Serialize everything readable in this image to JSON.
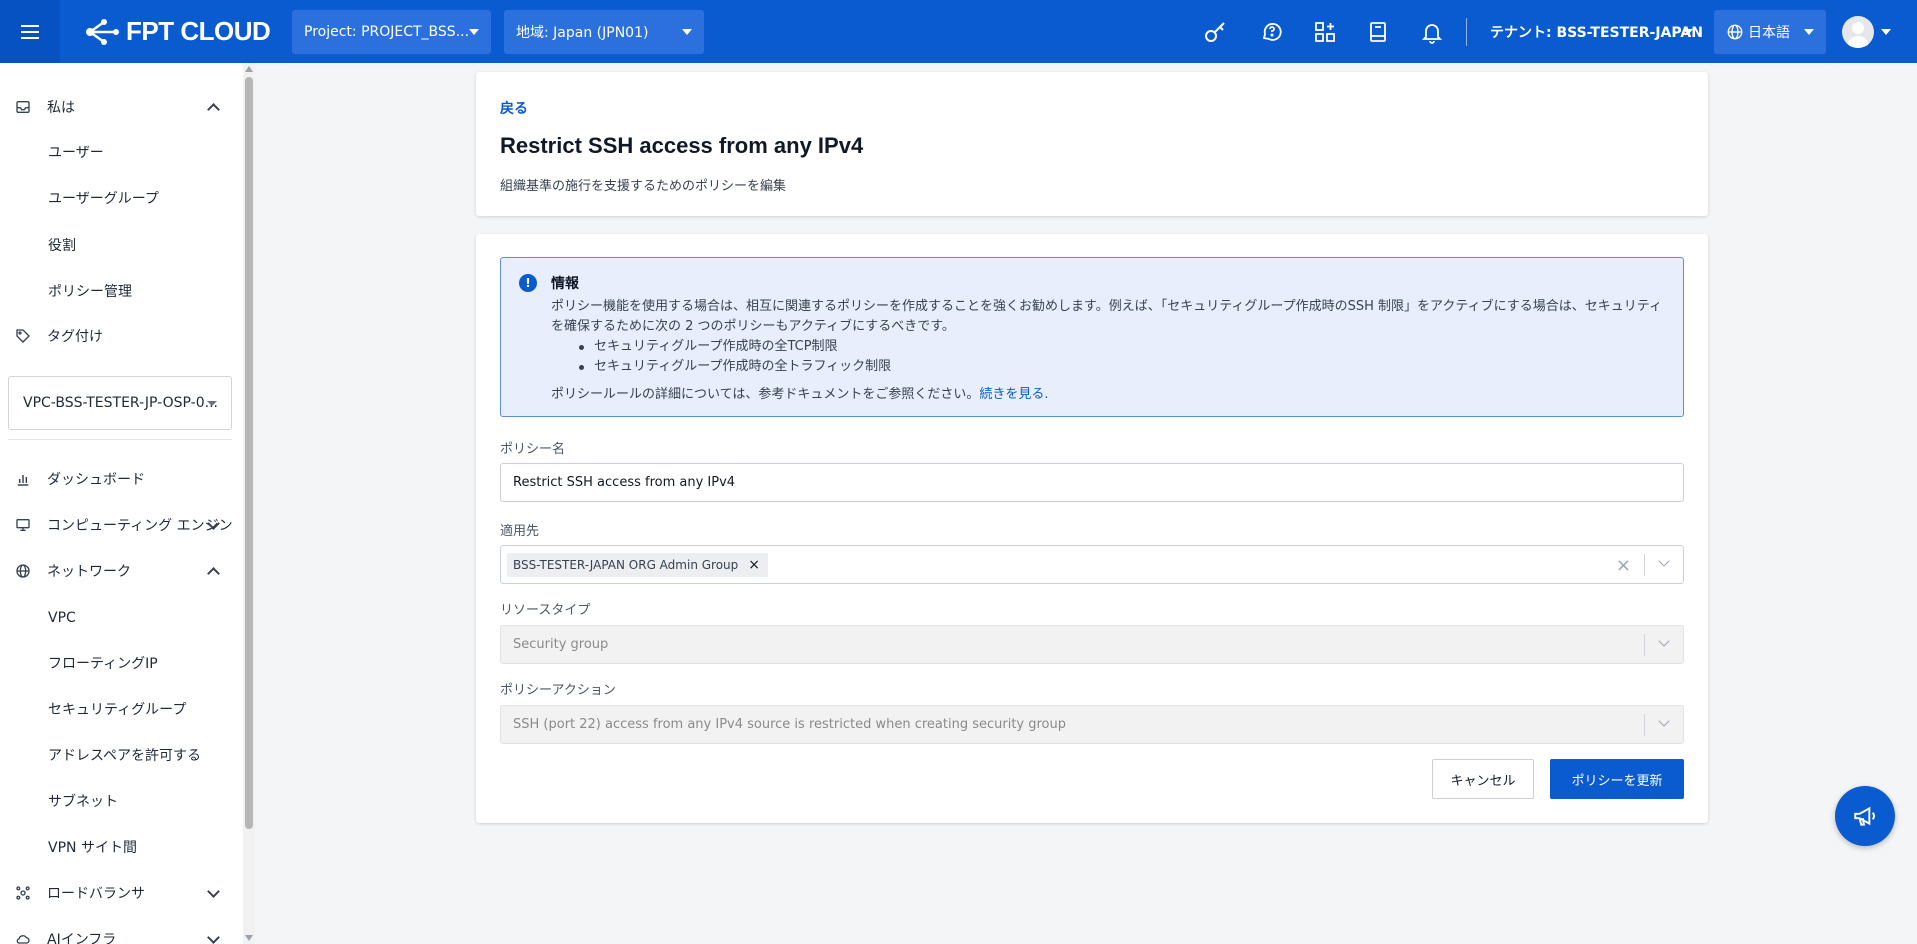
{
  "header": {
    "logo_text": "FPT CLOUD",
    "project_label": "Project: PROJECT_BSS...",
    "region_label": "地域: Japan (JPN01)",
    "tenant_label": "テナント: BSS-TESTER-JAPAN",
    "language_label": "日本語",
    "icons": [
      "key-icon",
      "support-chat-icon",
      "apps-add-icon",
      "book-icon",
      "bell-icon"
    ],
    "brand_color": "#0a5bd0"
  },
  "sidebar": {
    "iam_group": {
      "label": "私は",
      "expanded": true
    },
    "iam_items": [
      "ユーザー",
      "ユーザーグループ",
      "役割",
      "ポリシー管理"
    ],
    "tagging": "タグ付け",
    "vpc_select": "VPC-BSS-TESTER-JP-OSP-0...",
    "dashboard": "ダッシュボード",
    "compute": "コンピューティング エンジン",
    "network_group": {
      "label": "ネットワーク",
      "expanded": true
    },
    "network_items": [
      "VPC",
      "フローティングIP",
      "セキュリティグループ",
      "アドレスペアを許可する",
      "サブネット",
      "VPN サイト間"
    ],
    "load_balancer": "ロードバランサ",
    "ai_infra": "AIインフラ"
  },
  "page": {
    "back": "戻る",
    "title": "Restrict SSH access from any IPv4",
    "subtitle": "組織基準の施行を支援するためのポリシーを編集"
  },
  "info": {
    "title": "情報",
    "text": "ポリシー機能を使用する場合は、相互に関連するポリシーを作成することを強くお勧めします。例えば、「セキュリティグループ作成時のSSH 制限」をアクティブにする場合は、セキュリティを確保するために次の 2 つのポリシーもアクティブにするべきです。",
    "bullets": [
      "セキュリティグループ作成時の全TCP制限",
      "セキュリティグループ作成時の全トラフィック制限"
    ],
    "footer": "ポリシールールの詳細については、参考ドキュメントをご参照ください。",
    "link": "続きを見る."
  },
  "form": {
    "policy_name_label": "ポリシー名",
    "policy_name_value": "Restrict SSH access from any IPv4",
    "apply_to_label": "適用先",
    "apply_to_chip": "BSS-TESTER-JAPAN ORG Admin Group",
    "resource_type_label": "リソースタイプ",
    "resource_type_value": "Security group",
    "policy_action_label": "ポリシーアクション",
    "policy_action_value": "SSH (port 22) access from any IPv4 source is restricted when creating security group"
  },
  "buttons": {
    "cancel": "キャンセル",
    "update": "ポリシーを更新"
  }
}
